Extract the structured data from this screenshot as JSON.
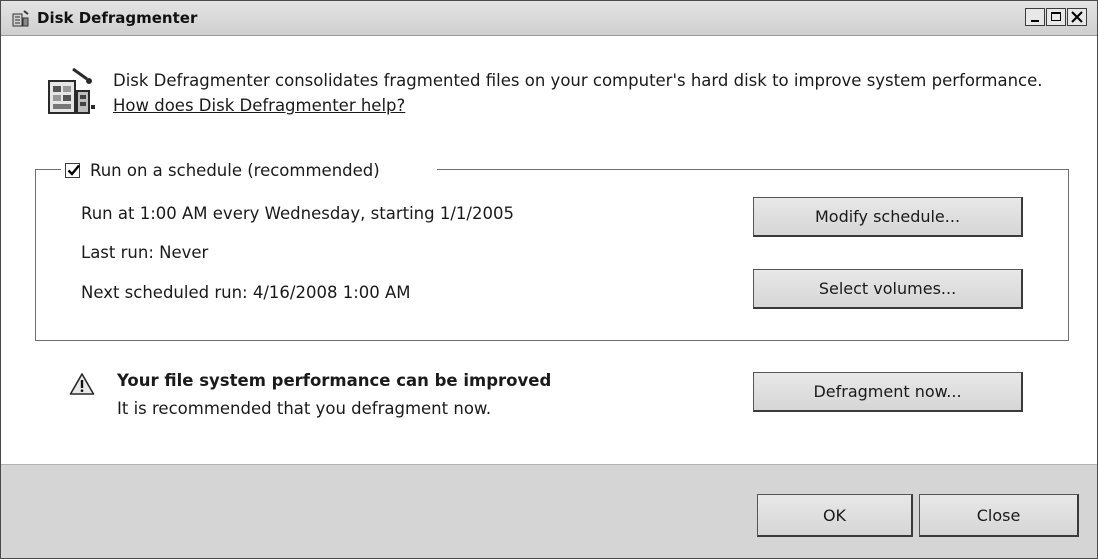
{
  "window": {
    "title": "Disk Defragmenter",
    "controls": [
      "minimize-icon",
      "maximize-icon",
      "close-icon"
    ]
  },
  "intro": {
    "text": "Disk Defragmenter consolidates fragmented files on your computer's hard disk to improve system performance. ",
    "link": "How does Disk Defragmenter help?"
  },
  "schedule": {
    "checkbox_label": "Run on a schedule (recommended)",
    "checked": true,
    "run_at": "Run at 1:00 AM every Wednesday, starting 1/1/2005",
    "last_run": "Last run: Never",
    "next_run": "Next scheduled run: 4/16/2008 1:00 AM",
    "modify_button": "Modify schedule...",
    "volumes_button": "Select volumes..."
  },
  "status": {
    "icon": "warning-icon",
    "title": "Your file system performance can be improved",
    "subtitle": "It is recommended that you defragment now.",
    "defrag_button": "Defragment now..."
  },
  "footer": {
    "ok_button": "OK",
    "close_button": "Close"
  },
  "colors": {
    "footer_bg": "#d5d5d5",
    "titlebar_bg": "#d8d8d8"
  }
}
